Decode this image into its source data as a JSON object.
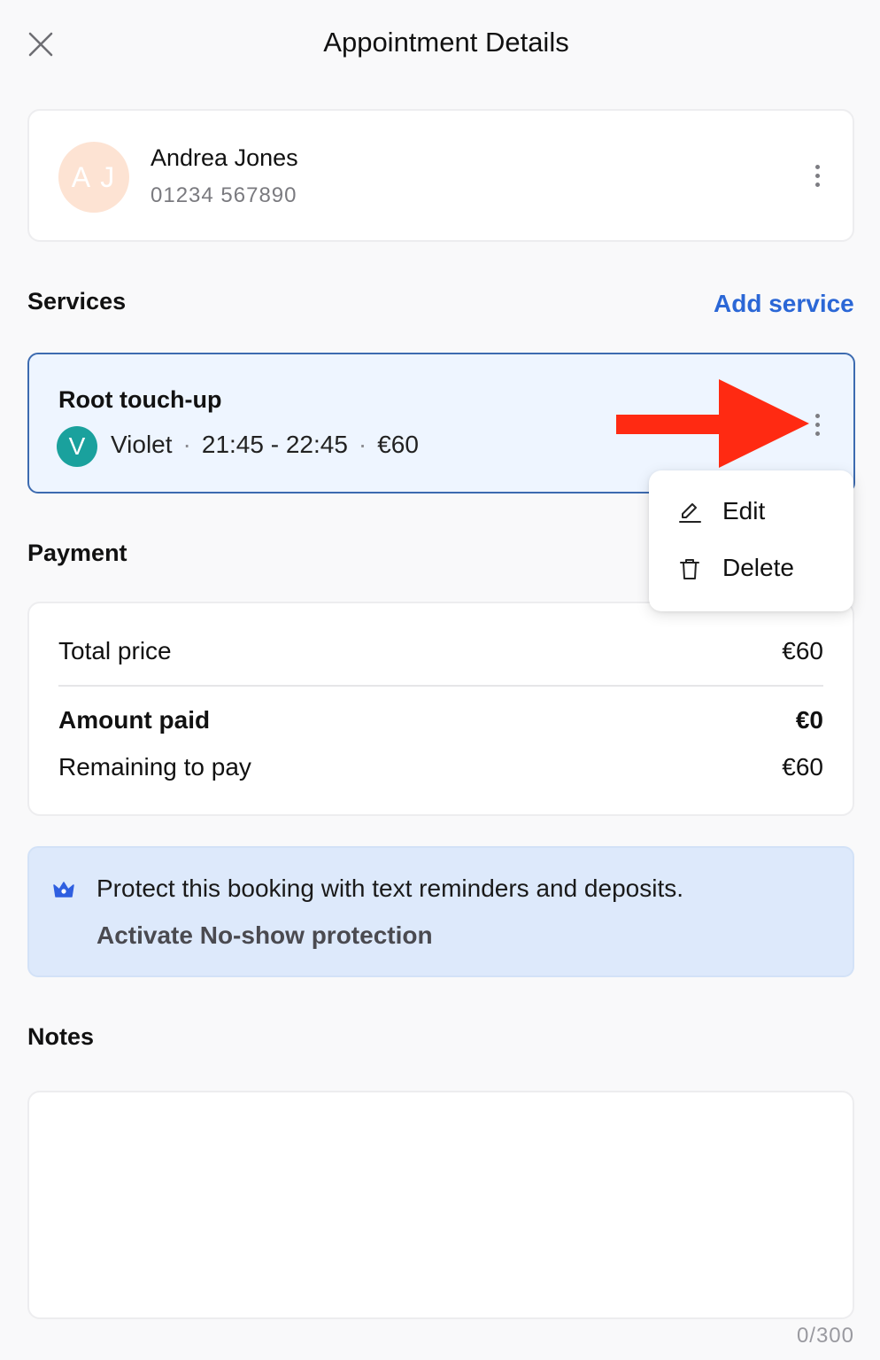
{
  "header": {
    "title": "Appointment Details",
    "close_icon": "close-icon"
  },
  "client": {
    "initials": "A J",
    "name": "Andrea Jones",
    "phone": "01234 567890",
    "avatar_color": "#fde3d3"
  },
  "services": {
    "heading": "Services",
    "add_label": "Add service",
    "items": [
      {
        "name": "Root touch-up",
        "staff_initial": "V",
        "staff_name": "Violet",
        "time": "21:45 - 22:45",
        "price": "€60",
        "staff_color": "#1aa19d"
      }
    ]
  },
  "context_menu": {
    "items": [
      {
        "label": "Edit",
        "icon": "pencil-icon"
      },
      {
        "label": "Delete",
        "icon": "trash-icon"
      }
    ]
  },
  "payment": {
    "heading": "Payment",
    "total_label": "Total price",
    "total_value": "€60",
    "paid_label": "Amount paid",
    "paid_value": "€0",
    "remaining_label": "Remaining to pay",
    "remaining_value": "€60"
  },
  "promo": {
    "icon": "crown-icon",
    "text": "Protect this booking with text reminders and deposits.",
    "link": "Activate No-show protection"
  },
  "notes": {
    "heading": "Notes",
    "value": "",
    "char_count": "0/300"
  },
  "colors": {
    "accent": "#2b67d6",
    "selected_border": "#3d6bb0",
    "annotation_arrow": "#ff2a12"
  }
}
